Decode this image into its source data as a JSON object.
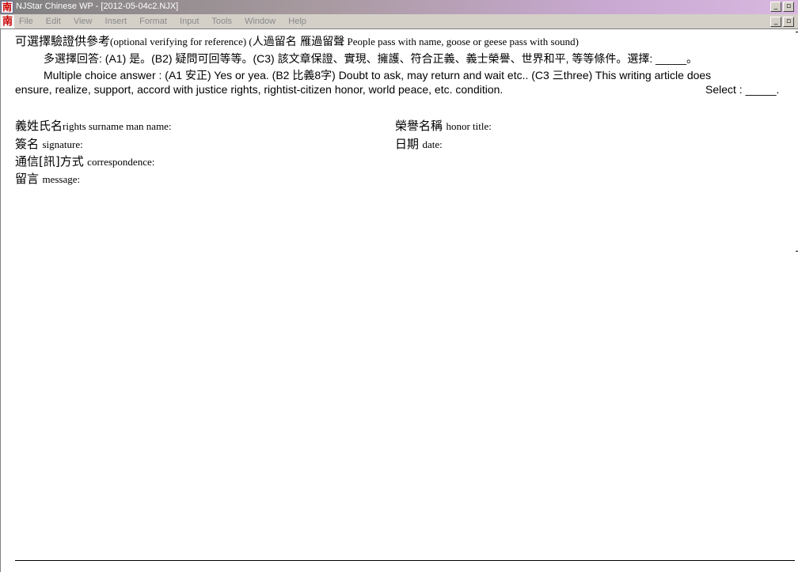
{
  "window": {
    "app_icon_glyph": "南",
    "title": "NJStar Chinese WP - [2012-05-04c2.NJX]",
    "minimize_glyph": "_",
    "restore_glyph": "▫"
  },
  "menubar": {
    "doc_icon_glyph": "南",
    "items": [
      "File",
      "Edit",
      "View",
      "Insert",
      "Format",
      "Input",
      "Tools",
      "Window",
      "Help"
    ]
  },
  "document": {
    "line1": {
      "cjk": "可選擇驗證供參考",
      "en": "(optional verifying for reference) (",
      "cjk2": "人過留名 雁過留聲",
      "en2": " People pass with name, goose or geese pass with sound)"
    },
    "line2": {
      "text": "多選擇回答: (A1) 是。(B2) 疑問可回等等。(C3) 該文章保證、實現、擁護、符合正義、義士榮譽、世界和平, 等等條件。選擇: _____。"
    },
    "line3": {
      "text": "Multiple choice answer : (A1 安正) Yes or yea.  (B2 比義8字) Doubt to ask, may return and wait etc..  (C3 三three) This writing article does"
    },
    "line4": {
      "text": "ensure, realize, support, accord with justice rights, rightist-citizen honor, world peace, etc. condition.",
      "select": "Select : _____."
    },
    "fields": {
      "name": {
        "cjk": "義姓氏名",
        "en": "rights surname man name:"
      },
      "title": {
        "cjk": "榮譽名稱",
        "en": "honor title:"
      },
      "signature": {
        "cjk": "簽名",
        "en": "signature:"
      },
      "date": {
        "cjk": "日期",
        "en": "date:"
      },
      "correspondence": {
        "cjk": "通信[訊]方式",
        "en": "correspondence:"
      },
      "message": {
        "cjk": "留言",
        "en": "message:"
      }
    }
  }
}
